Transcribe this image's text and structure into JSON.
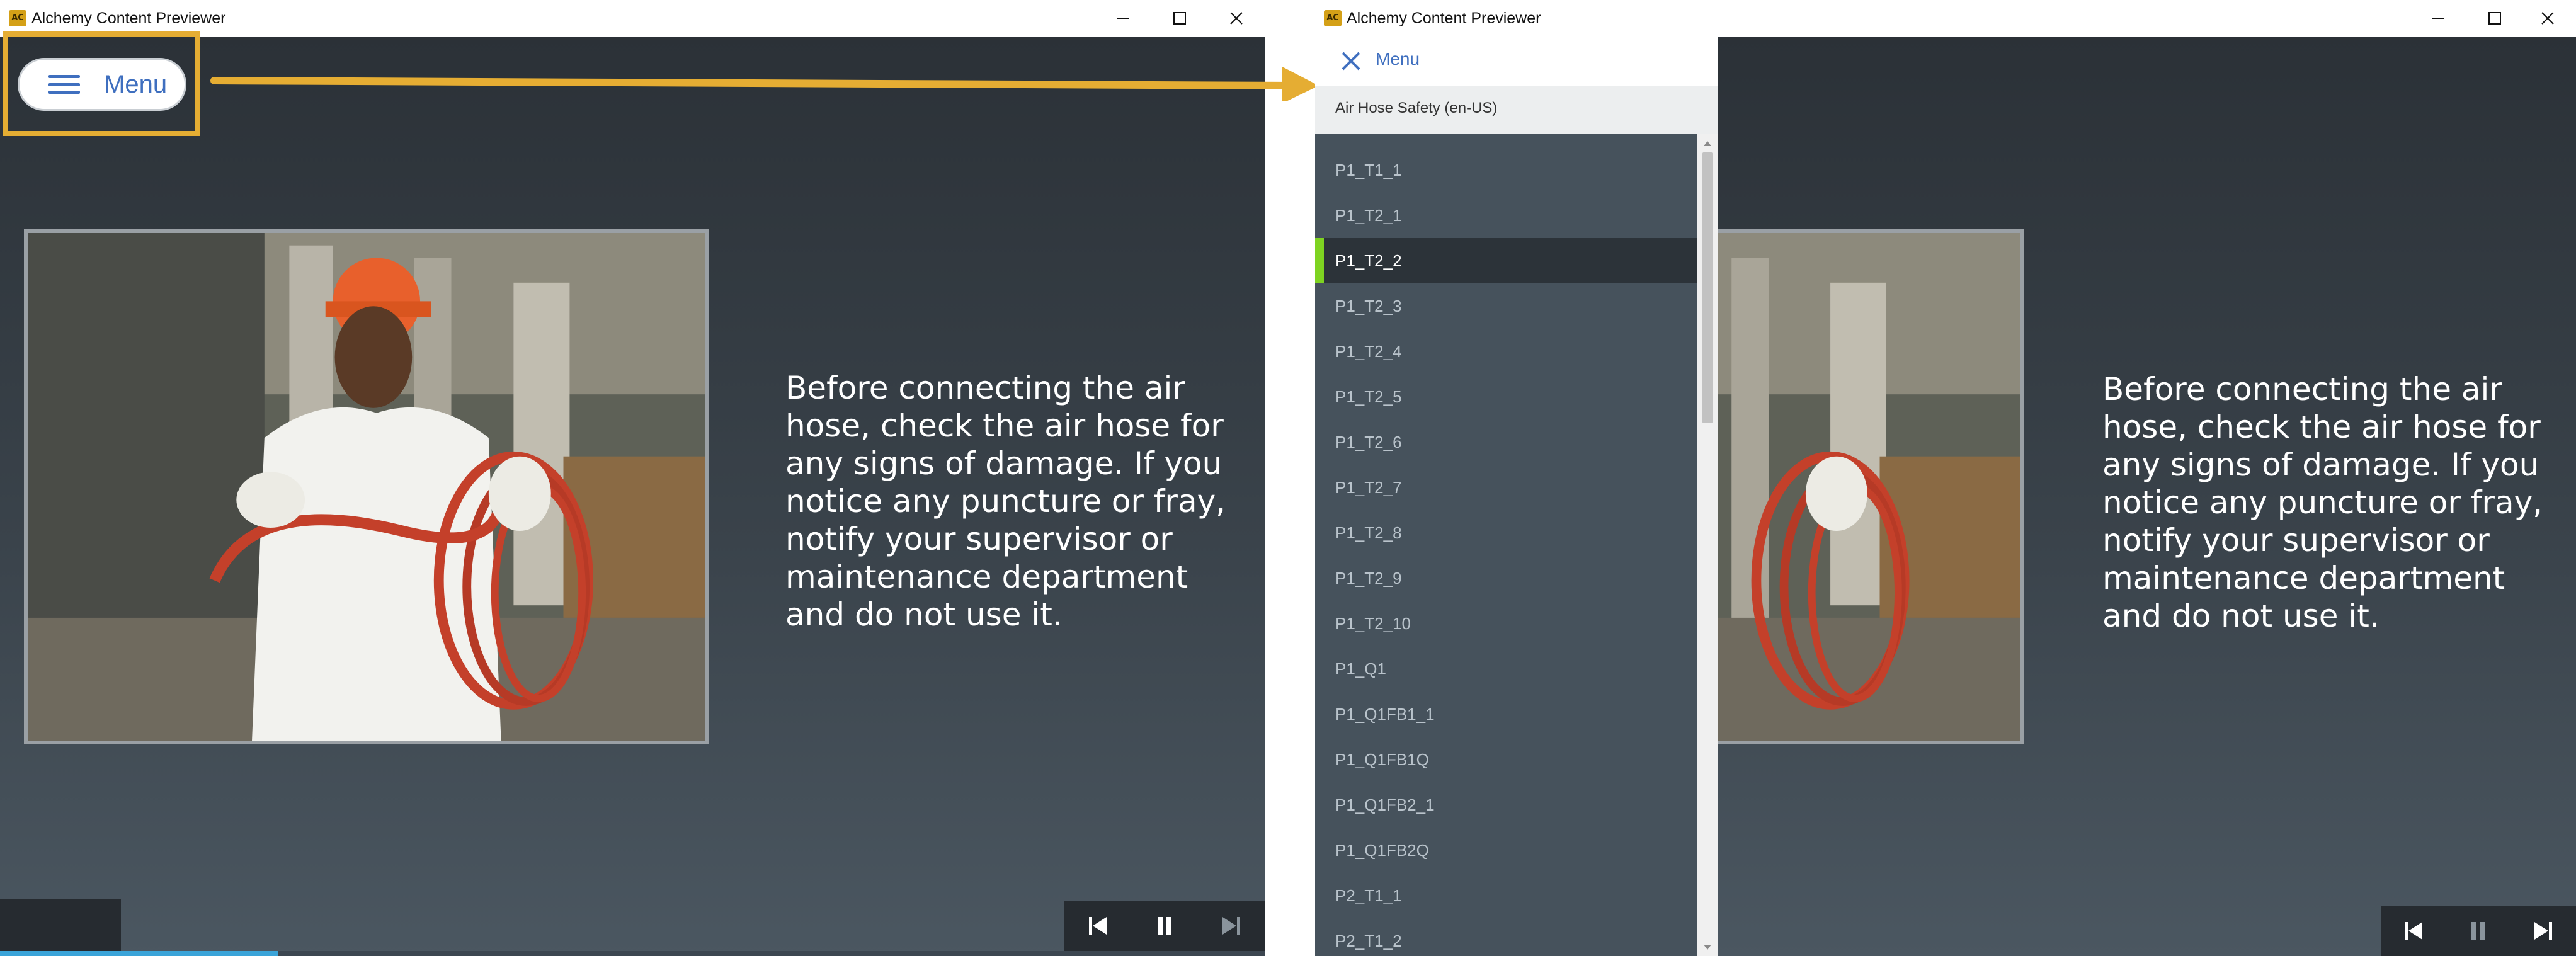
{
  "window": {
    "title": "Alchemy Content Previewer",
    "icon_text": "AC"
  },
  "menu_button": {
    "label": "Menu"
  },
  "slide": {
    "lines": [
      "Before connecting the air",
      "hose, check the air hose for",
      "any signs of damage. If you",
      "notice any puncture or fray,",
      "notify your supervisor or",
      "maintenance department",
      "and do not use it."
    ]
  },
  "playback": {
    "progress": 0.22
  },
  "menu_panel": {
    "title": "Menu",
    "course": "Air Hose Safety (en-US)",
    "items": [
      "P1_T1_1",
      "P1_T2_1",
      "P1_T2_2",
      "P1_T2_3",
      "P1_T2_4",
      "P1_T2_5",
      "P1_T2_6",
      "P1_T2_7",
      "P1_T2_8",
      "P1_T2_9",
      "P1_T2_10",
      "P1_Q1",
      "P1_Q1FB1_1",
      "P1_Q1FB1Q",
      "P1_Q1FB2_1",
      "P1_Q1FB2Q",
      "P2_T1_1",
      "P2_T1_2"
    ],
    "active_item": "P1_T2_2"
  },
  "colors": {
    "accent": "#3f6fbf",
    "highlight": "#e5ad33",
    "active_marker": "#7ed321"
  }
}
